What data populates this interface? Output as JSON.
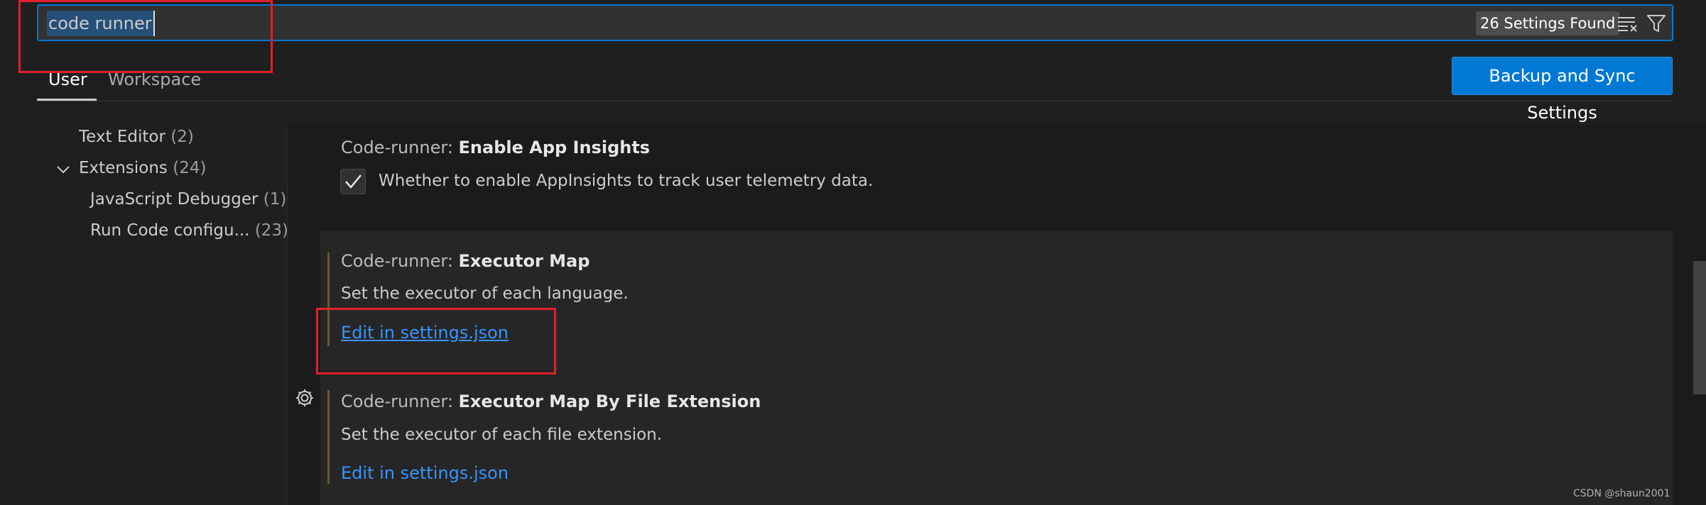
{
  "search": {
    "query": "code runner",
    "results_badge": "26 Settings Found",
    "clear_icon": "clear-filter-icon",
    "filter_icon": "filter-icon"
  },
  "tabs": [
    {
      "label": "User",
      "active": true
    },
    {
      "label": "Workspace",
      "active": false
    }
  ],
  "sync_button": "Backup and Sync Settings",
  "toc": [
    {
      "label": "Text Editor",
      "count": "(2)"
    },
    {
      "label": "Extensions",
      "count": "(24)",
      "expanded": true
    },
    {
      "label": "JavaScript Debugger",
      "count": "(1)"
    },
    {
      "label": "Run Code configu...",
      "count": "(23)"
    }
  ],
  "settings": [
    {
      "prefix": "Code-runner: ",
      "name": "Enable App Insights",
      "checkbox_label": "Whether to enable AppInsights to track user telemetry data.",
      "checked": true
    },
    {
      "prefix": "Code-runner: ",
      "name": "Executor Map",
      "description": "Set the executor of each language.",
      "link": "Edit in settings.json"
    },
    {
      "prefix": "Code-runner: ",
      "name": "Executor Map By File Extension",
      "description": "Set the executor of each file extension.",
      "link": "Edit in settings.json"
    }
  ],
  "watermark": "CSDN @shaun2001",
  "colors": {
    "accent": "#0078d4",
    "link": "#3794ff",
    "annotation": "#e0202a",
    "modified_bar": "#6b5a2f"
  }
}
